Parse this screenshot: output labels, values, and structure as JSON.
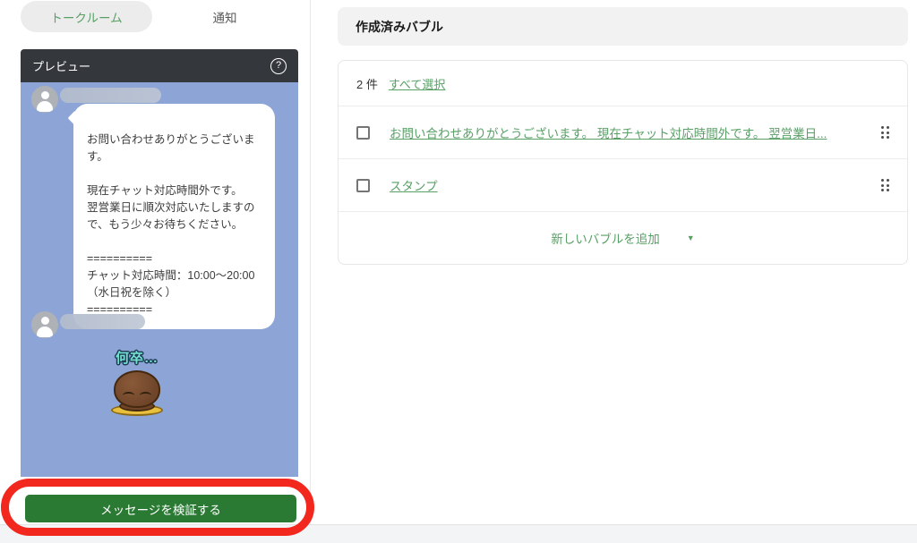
{
  "colors": {
    "accent_green": "#58a066",
    "button_green": "#2b7a34",
    "chat_blue": "#8da5d6",
    "preview_header_dark": "#34383d",
    "annotation_red": "#f2281e"
  },
  "tabs": {
    "talk_room": "トークルーム",
    "notification": "通知"
  },
  "preview": {
    "title": "プレビュー",
    "help_icon": "?",
    "auto_reply_message": "お問い合わせありがとうございます。\n\n現在チャット対応時間外です。\n翌営業日に順次対応いたしますので、もう少々お待ちください。\n\n==========\nチャット対応時間：10:00～20:00\n（水日祝を除く）\n==========",
    "sticker_caption": "何卒…",
    "verify_button": "メッセージを検証する"
  },
  "bubble_panel": {
    "header": "作成済みバブル",
    "count_label": "2 件",
    "select_all": "すべて選択",
    "rows": [
      {
        "label": "お問い合わせありがとうございます。 現在チャット対応時間外です。 翌営業日..."
      },
      {
        "label": "スタンプ"
      }
    ],
    "add_bubble": "新しいバブルを追加",
    "caret": "▼"
  }
}
